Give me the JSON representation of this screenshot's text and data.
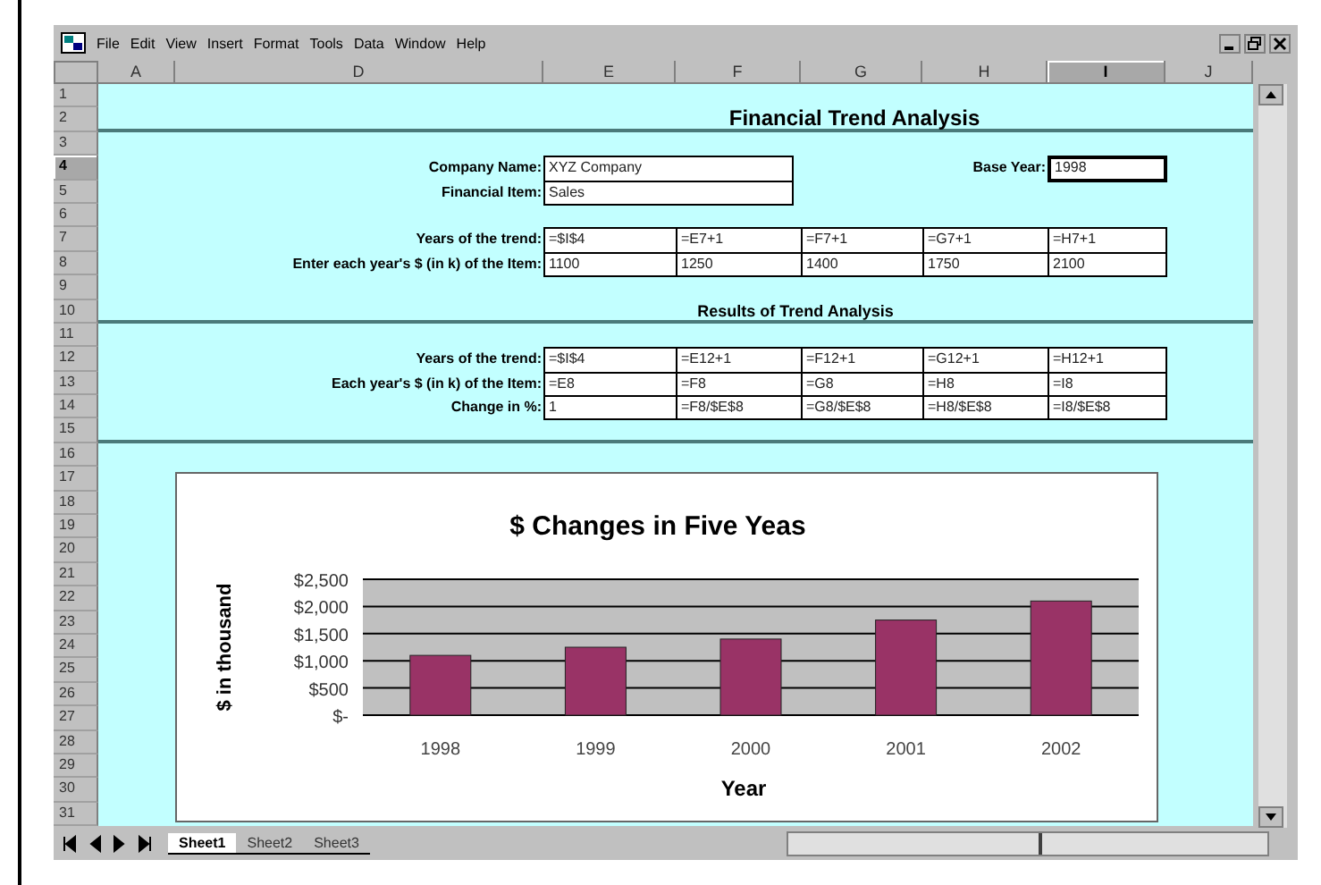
{
  "window": {
    "menu": [
      "File",
      "Edit",
      "View",
      "Insert",
      "Format",
      "Tools",
      "Data",
      "Window",
      "Help"
    ]
  },
  "columns": [
    {
      "label": "A",
      "selected": false
    },
    {
      "label": "D",
      "selected": false
    },
    {
      "label": "E",
      "selected": false
    },
    {
      "label": "F",
      "selected": false
    },
    {
      "label": "G",
      "selected": false
    },
    {
      "label": "H",
      "selected": false
    },
    {
      "label": "I",
      "selected": true
    },
    {
      "label": "J",
      "selected": false
    }
  ],
  "rows": [
    {
      "label": "1",
      "selected": false
    },
    {
      "label": "2",
      "selected": false
    },
    {
      "label": "3",
      "selected": false
    },
    {
      "label": "4",
      "selected": true
    },
    {
      "label": "5",
      "selected": false
    },
    {
      "label": "6",
      "selected": false
    },
    {
      "label": "7",
      "selected": false
    },
    {
      "label": "8",
      "selected": false
    },
    {
      "label": "9",
      "selected": false
    },
    {
      "label": "10",
      "selected": false
    },
    {
      "label": "11",
      "selected": false
    },
    {
      "label": "12",
      "selected": false
    },
    {
      "label": "13",
      "selected": false
    },
    {
      "label": "14",
      "selected": false
    },
    {
      "label": "15",
      "selected": false
    },
    {
      "label": "16",
      "selected": false
    },
    {
      "label": "17",
      "selected": false
    },
    {
      "label": "18",
      "selected": false
    },
    {
      "label": "19",
      "selected": false
    },
    {
      "label": "20",
      "selected": false
    },
    {
      "label": "21",
      "selected": false
    },
    {
      "label": "22",
      "selected": false
    },
    {
      "label": "23",
      "selected": false
    },
    {
      "label": "24",
      "selected": false
    },
    {
      "label": "25",
      "selected": false
    },
    {
      "label": "26",
      "selected": false
    },
    {
      "label": "27",
      "selected": false
    },
    {
      "label": "28",
      "selected": false
    },
    {
      "label": "29",
      "selected": false
    },
    {
      "label": "30",
      "selected": false
    },
    {
      "label": "31",
      "selected": false
    }
  ],
  "sheet": {
    "title": "Financial Trend Analysis",
    "company": {
      "label": "Company Name:",
      "value": "XYZ Company"
    },
    "item": {
      "label": "Financial Item:",
      "value": "Sales"
    },
    "base_year": {
      "label": "Base Year:",
      "value": "1998"
    },
    "input_rows": [
      {
        "label": "Years of the trend:",
        "cells": [
          "=$I$4",
          "=E7+1",
          "=F7+1",
          "=G7+1",
          "=H7+1"
        ]
      },
      {
        "label": "Enter each year's $ (in k) of the Item:",
        "cells": [
          "1100",
          "1250",
          "1400",
          "1750",
          "2100"
        ]
      }
    ],
    "results_title": "Results of Trend Analysis",
    "result_rows": [
      {
        "label": "Years of the trend:",
        "cells": [
          "=$I$4",
          "=E12+1",
          "=F12+1",
          "=G12+1",
          "=H12+1"
        ]
      },
      {
        "label": "Each year's $ (in k) of the Item:",
        "cells": [
          "=E8",
          "=F8",
          "=G8",
          "=H8",
          "=I8"
        ]
      },
      {
        "label": "Change in %:",
        "cells": [
          "1",
          "=F8/$E$8",
          "=G8/$E$8",
          "=H8/$E$8",
          "=I8/$E$8"
        ]
      }
    ]
  },
  "chart": {
    "chart_data": {
      "type": "bar",
      "title": "$ Changes in Five Yeas",
      "xlabel": "Year",
      "ylabel": "$ in thousand",
      "categories": [
        "1998",
        "1999",
        "2000",
        "2001",
        "2002"
      ],
      "series": [
        {
          "color": "#993366",
          "values": [
            1100,
            1250,
            1400,
            1750,
            2100
          ]
        }
      ],
      "grid": true,
      "ylim": [
        0,
        2500
      ],
      "yticks": [
        {
          "value": 0,
          "label": "$-"
        },
        {
          "value": 500,
          "label": "$500"
        },
        {
          "value": 1000,
          "label": "$1,000"
        },
        {
          "value": 1500,
          "label": "$1,500"
        },
        {
          "value": 2000,
          "label": "$2,000"
        },
        {
          "value": 2500,
          "label": "$2,500"
        }
      ]
    }
  },
  "sheet_tabs": [
    {
      "label": "Sheet1",
      "selected": true
    },
    {
      "label": "Sheet2",
      "selected": false
    },
    {
      "label": "Sheet3",
      "selected": false
    }
  ]
}
